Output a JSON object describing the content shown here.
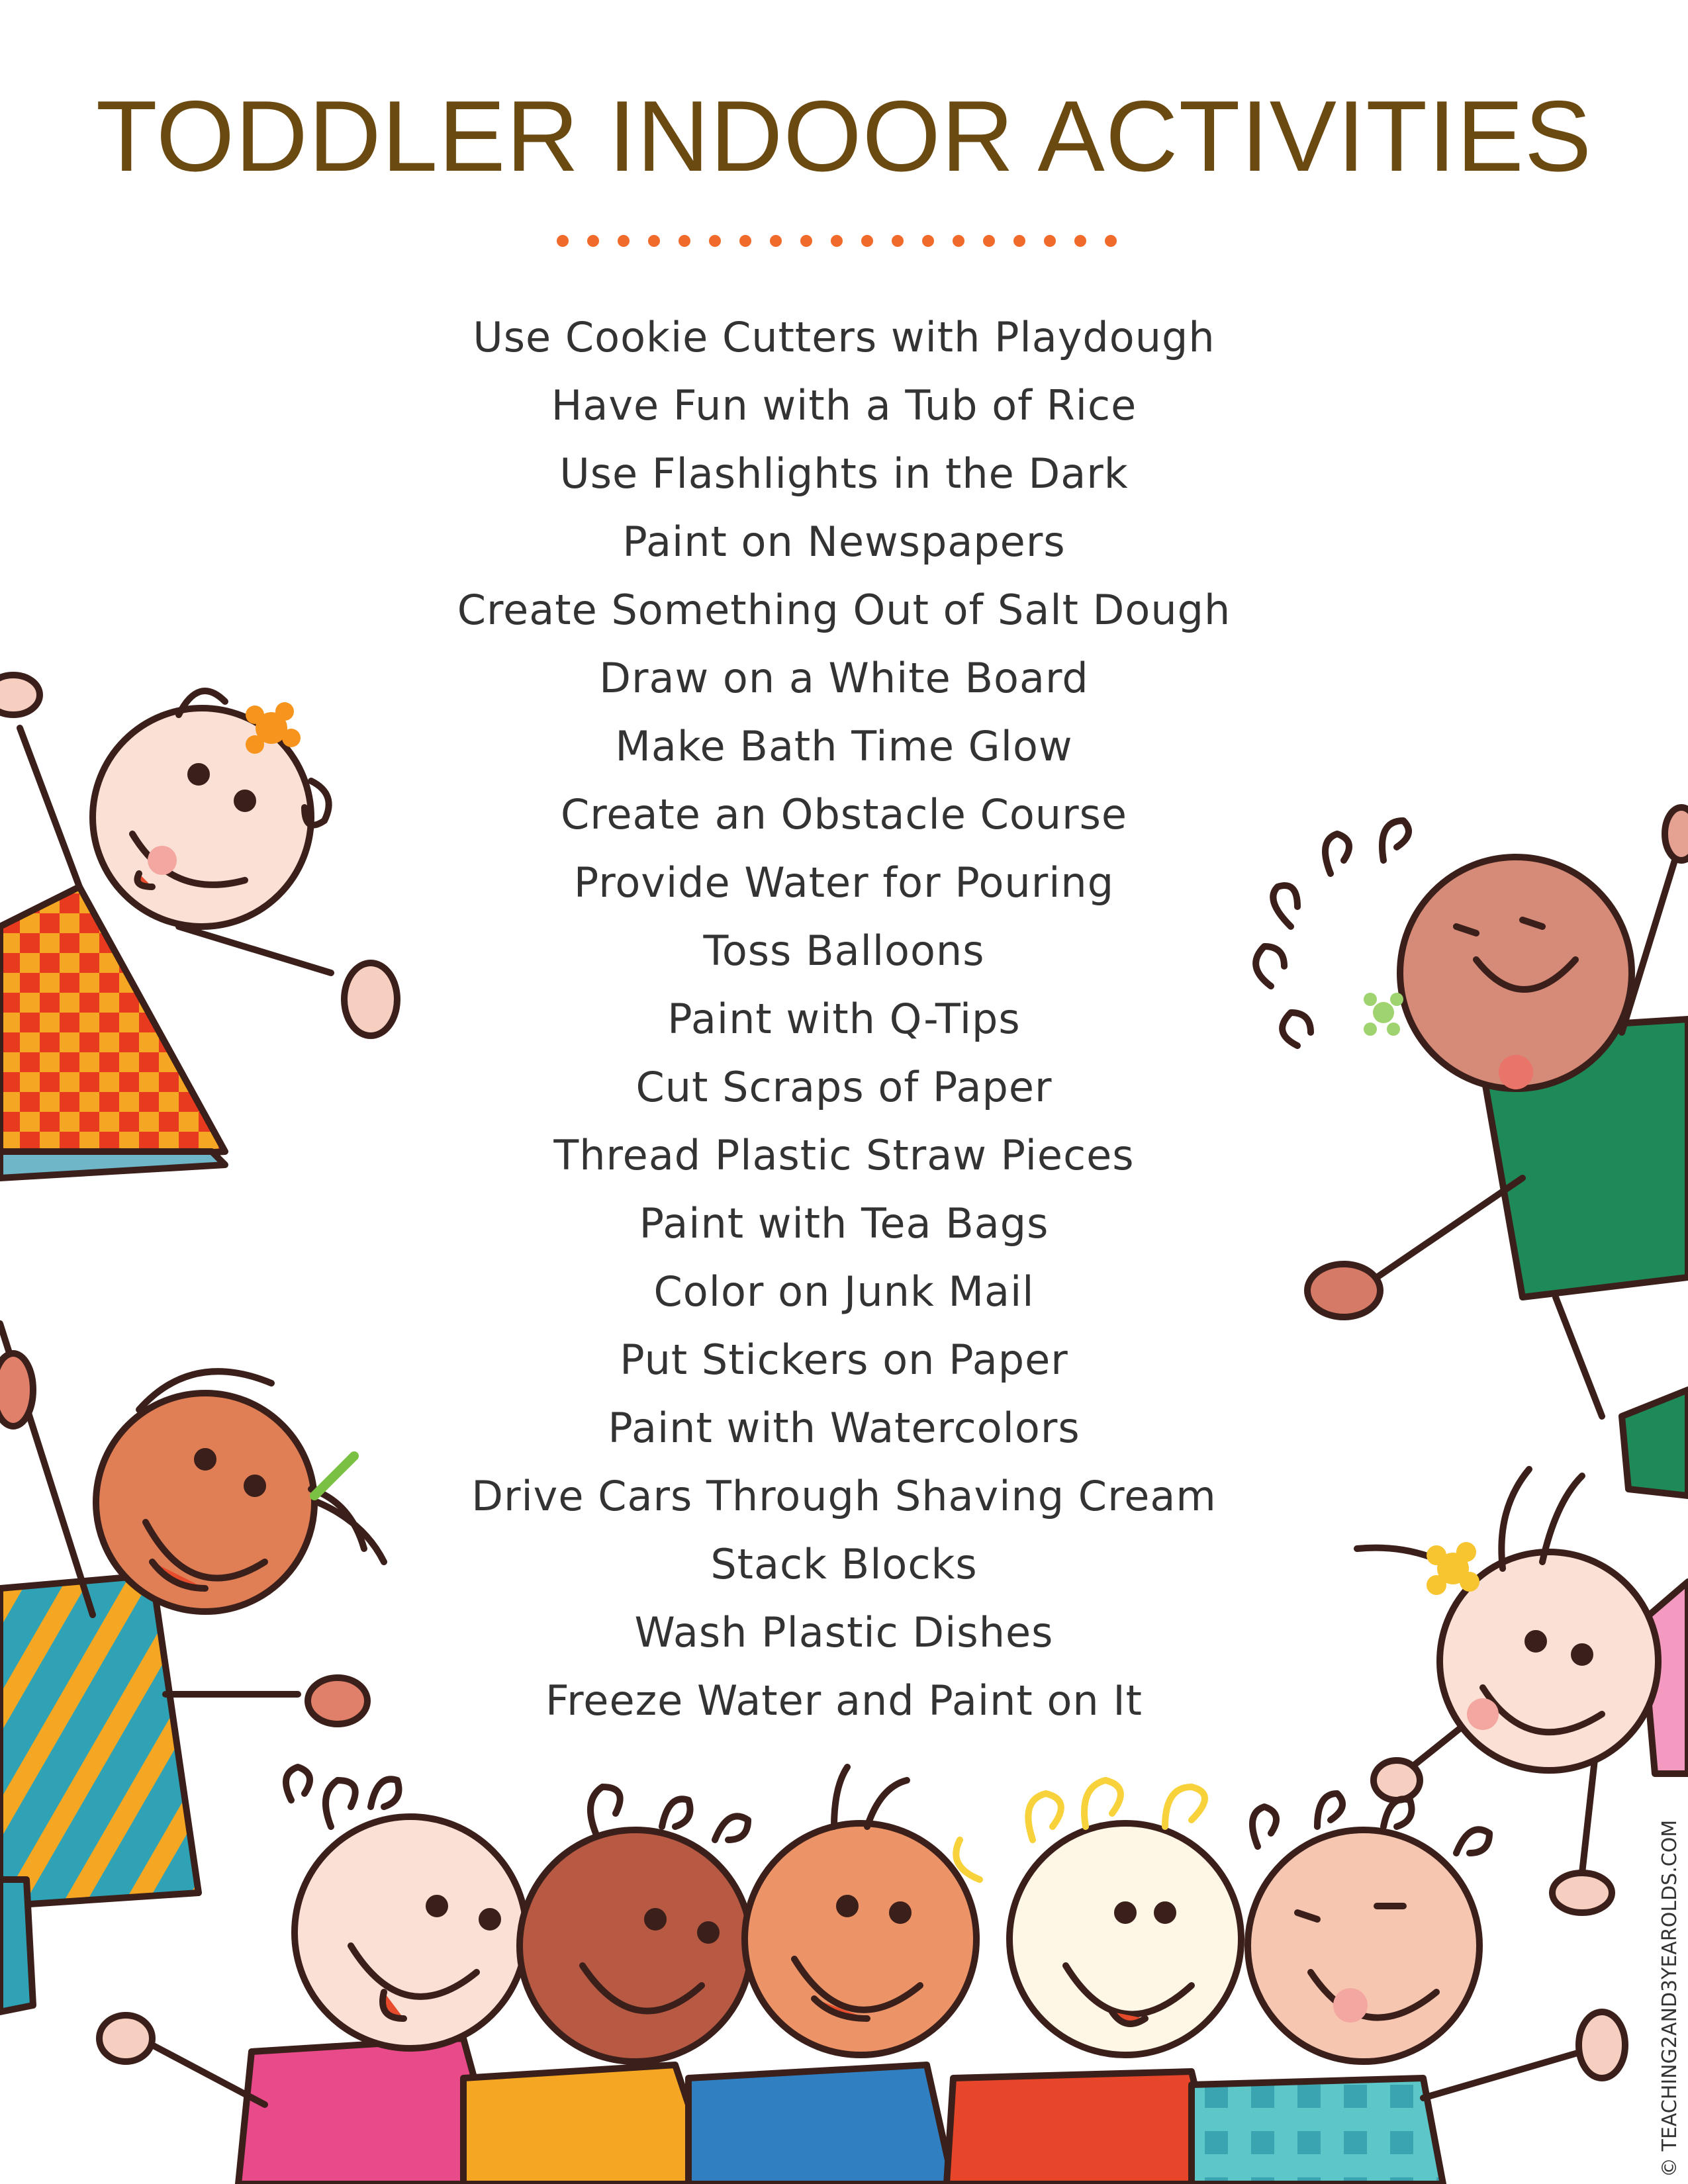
{
  "title": "TODDLER INDOOR ACTIVITIES",
  "colors": {
    "title": "#6b4a12",
    "dots": "#f06a2b",
    "text": "#333333"
  },
  "activities": [
    "Use Cookie Cutters with Playdough",
    "Have Fun with a Tub of Rice",
    "Use Flashlights in the Dark",
    "Paint on Newspapers",
    "Create Something Out of Salt Dough",
    "Draw on a White Board",
    "Make Bath Time Glow",
    "Create an Obstacle Course",
    "Provide Water for Pouring",
    "Toss Balloons",
    "Paint with Q-Tips",
    "Cut Scraps of Paper",
    "Thread Plastic Straw Pieces",
    "Paint with Tea Bags",
    "Color on Junk Mail",
    "Put Stickers on Paper",
    "Paint with Watercolors",
    "Drive Cars Through Shaving Cream",
    "Stack Blocks",
    "Wash Plastic Dishes",
    "Freeze Water and Paint on It"
  ],
  "credit": "© TEACHING2AND3YEAROLDS.COM"
}
